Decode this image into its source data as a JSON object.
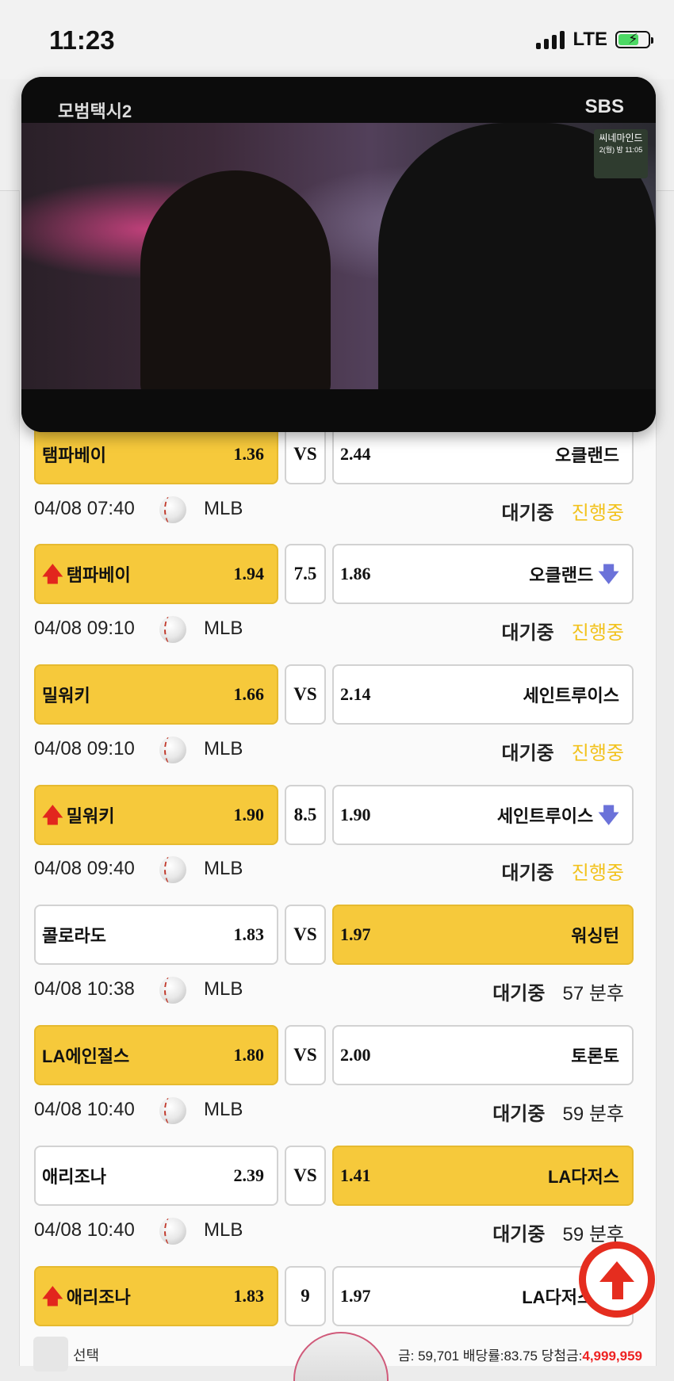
{
  "status_bar": {
    "time": "11:23",
    "network": "LTE"
  },
  "video": {
    "logo_text": "모범택시2",
    "channel": "SBS",
    "badge_title": "씨네마인드",
    "badge_time": "2(월) 밤 11:05"
  },
  "matches": [
    {
      "home": "탬파베이",
      "home_odds": "1.36",
      "mid": "VS",
      "away_odds": "2.44",
      "away": "오클랜드",
      "highlight": "home",
      "home_arrow": "",
      "away_arrow": ""
    },
    {
      "home": "탬파베이",
      "home_odds": "1.94",
      "mid": "7.5",
      "away_odds": "1.86",
      "away": "오클랜드",
      "highlight": "home",
      "home_arrow": "up",
      "away_arrow": "down"
    },
    {
      "home": "밀워키",
      "home_odds": "1.66",
      "mid": "VS",
      "away_odds": "2.14",
      "away": "세인트루이스",
      "highlight": "home",
      "home_arrow": "",
      "away_arrow": ""
    },
    {
      "home": "밀워키",
      "home_odds": "1.90",
      "mid": "8.5",
      "away_odds": "1.90",
      "away": "세인트루이스",
      "highlight": "home",
      "home_arrow": "up",
      "away_arrow": "down"
    },
    {
      "home": "콜로라도",
      "home_odds": "1.83",
      "mid": "VS",
      "away_odds": "1.97",
      "away": "워싱턴",
      "highlight": "away",
      "home_arrow": "",
      "away_arrow": ""
    },
    {
      "home": "LA에인절스",
      "home_odds": "1.80",
      "mid": "VS",
      "away_odds": "2.00",
      "away": "토론토",
      "highlight": "home",
      "home_arrow": "",
      "away_arrow": ""
    },
    {
      "home": "애리조나",
      "home_odds": "2.39",
      "mid": "VS",
      "away_odds": "1.41",
      "away": "LA다저스",
      "highlight": "away",
      "home_arrow": "",
      "away_arrow": ""
    },
    {
      "home": "애리조나",
      "home_odds": "1.83",
      "mid": "9",
      "away_odds": "1.97",
      "away": "LA다저스",
      "highlight": "home",
      "home_arrow": "up",
      "away_arrow": "down"
    }
  ],
  "infos": [
    {
      "date": "04/08 07:40",
      "league": "MLB",
      "wait": "대기중",
      "status": "진행중",
      "status_kind": "live"
    },
    {
      "date": "04/08 09:10",
      "league": "MLB",
      "wait": "대기중",
      "status": "진행중",
      "status_kind": "live"
    },
    {
      "date": "04/08 09:10",
      "league": "MLB",
      "wait": "대기중",
      "status": "진행중",
      "status_kind": "live"
    },
    {
      "date": "04/08 09:40",
      "league": "MLB",
      "wait": "대기중",
      "status": "진행중",
      "status_kind": "live"
    },
    {
      "date": "04/08 10:38",
      "league": "MLB",
      "wait": "대기중",
      "status": "57 분후",
      "status_kind": "remain"
    },
    {
      "date": "04/08 10:40",
      "league": "MLB",
      "wait": "대기중",
      "status": "59 분후",
      "status_kind": "remain"
    },
    {
      "date": "04/08 10:40",
      "league": "MLB",
      "wait": "대기중",
      "status": "59 분후",
      "status_kind": "remain"
    }
  ],
  "footer": {
    "select_label": "선택",
    "stats_text": "금: 59,701 배당률:83.75 당첨금:",
    "win_amount": "4,999,959"
  },
  "colors": {
    "highlight": "#f6c93b",
    "live": "#f2c21d",
    "up_arrow": "#e2261d",
    "down_arrow": "#6b72d9",
    "scroll_top": "#e52d1f"
  }
}
